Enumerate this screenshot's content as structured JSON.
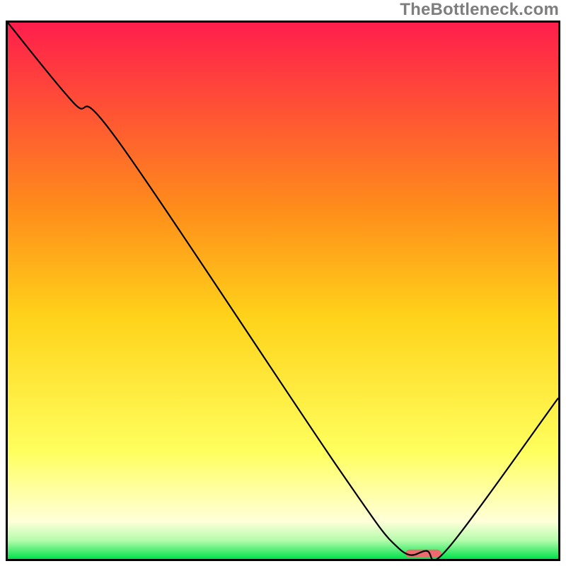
{
  "watermark": "TheBottleneck.com",
  "chart_data": {
    "type": "line",
    "title": "",
    "xlabel": "",
    "ylabel": "",
    "xlim": [
      0,
      100
    ],
    "ylim": [
      0,
      100
    ],
    "grid": false,
    "legend": null,
    "background_gradient": {
      "stops": [
        {
          "offset": 0.0,
          "color": "#ff1e4c"
        },
        {
          "offset": 0.35,
          "color": "#ff8e1a"
        },
        {
          "offset": 0.55,
          "color": "#ffd31a"
        },
        {
          "offset": 0.8,
          "color": "#ffff5e"
        },
        {
          "offset": 0.93,
          "color": "#ffffd9"
        },
        {
          "offset": 0.965,
          "color": "#b6fcad"
        },
        {
          "offset": 1.0,
          "color": "#00e24a"
        }
      ]
    },
    "series": [
      {
        "name": "curve",
        "x": [
          0,
          12,
          20,
          60,
          71,
          76,
          80,
          100
        ],
        "y": [
          100,
          85,
          78,
          17,
          2,
          1.5,
          2,
          30
        ]
      }
    ],
    "marker": {
      "x": 75.5,
      "y": 1.0,
      "width": 6.5,
      "height": 1.5,
      "color": "#ed6a6e"
    }
  }
}
